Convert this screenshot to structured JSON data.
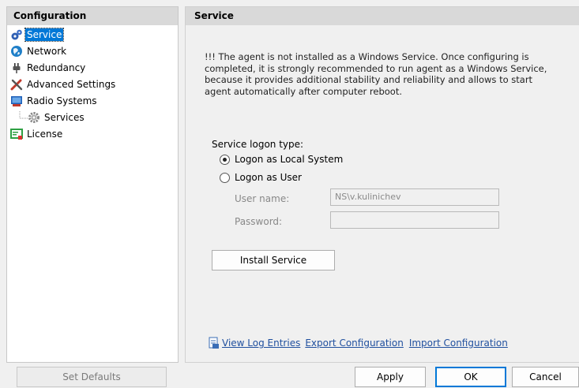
{
  "left": {
    "header": "Configuration",
    "items": [
      {
        "label": "Service",
        "icon": "service-gear-icon",
        "selected": true
      },
      {
        "label": "Network",
        "icon": "network-globe-icon"
      },
      {
        "label": "Redundancy",
        "icon": "redundancy-plug-icon"
      },
      {
        "label": "Advanced Settings",
        "icon": "tools-icon"
      },
      {
        "label": "Radio Systems",
        "icon": "radio-systems-icon"
      },
      {
        "label": "Services",
        "icon": "gear-icon"
      },
      {
        "label": "License",
        "icon": "license-icon"
      }
    ]
  },
  "right": {
    "header": "Service",
    "warning": "!!! The agent is not installed as a Windows Service. Once configuring is completed, it is strongly recommended to run agent as a Windows Service, because it provides additional stability and reliability and allows to start agent automatically after computer reboot.",
    "logon_type_label": "Service logon type:",
    "radio_local": "Logon as Local System",
    "radio_user": "Logon as User",
    "username_label": "User name:",
    "username_value": "NS\\v.kulinichev",
    "password_label": "Password:",
    "password_value": "",
    "install_button": "Install Service",
    "links": {
      "view_log": "View Log Entries",
      "export": "Export Configuration",
      "import": "Import Configuration"
    }
  },
  "footer": {
    "set_defaults": "Set Defaults",
    "apply": "Apply",
    "ok": "OK",
    "cancel": "Cancel"
  }
}
